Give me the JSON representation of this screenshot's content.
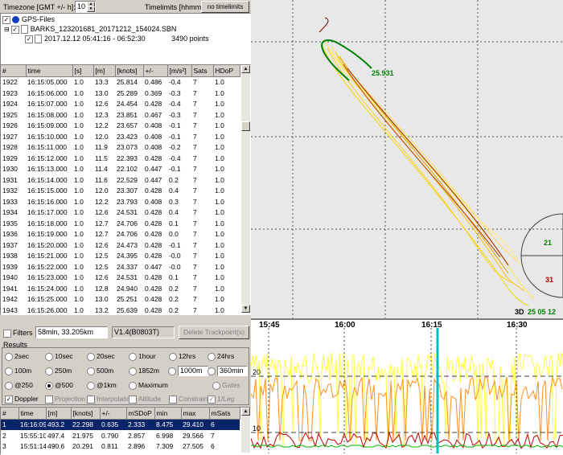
{
  "header": {
    "timezone_label": "Timezone [GMT +/- h]:",
    "timezone_value": "10",
    "timelimits_label": "Timelimits [hhmm]:",
    "timelimits_button": "no timelimits"
  },
  "tree": {
    "root_label": "GPS-Files",
    "file_label": "BARKS_123201681_20171212_154024.SBN",
    "segment_label": "2017.12.12 05:41:16 - 06:52:30",
    "points_label": "3490 points"
  },
  "trackpoints": {
    "columns": [
      "#",
      "time",
      "[s]",
      "[m]",
      "[knots]",
      "+/-",
      "[m/s²]",
      "Sats",
      "HDoP"
    ],
    "rows": [
      [
        "1922",
        "16:15:05.000",
        "1.0",
        "13.3",
        "25.814",
        "0.486",
        "-0.4",
        "7",
        "1.0"
      ],
      [
        "1923",
        "16:15:06.000",
        "1.0",
        "13.0",
        "25.289",
        "0.369",
        "-0.3",
        "7",
        "1.0"
      ],
      [
        "1924",
        "16:15:07.000",
        "1.0",
        "12.6",
        "24.454",
        "0.428",
        "-0.4",
        "7",
        "1.0"
      ],
      [
        "1925",
        "16:15:08.000",
        "1.0",
        "12.3",
        "23.851",
        "0.467",
        "-0.3",
        "7",
        "1.0"
      ],
      [
        "1926",
        "16:15:09.000",
        "1.0",
        "12.2",
        "23.657",
        "0.408",
        "-0.1",
        "7",
        "1.0"
      ],
      [
        "1927",
        "16:15:10.000",
        "1.0",
        "12.0",
        "23.423",
        "0.408",
        "-0.1",
        "7",
        "1.0"
      ],
      [
        "1928",
        "16:15:11.000",
        "1.0",
        "11.9",
        "23.073",
        "0.408",
        "-0.2",
        "7",
        "1.0"
      ],
      [
        "1929",
        "16:15:12.000",
        "1.0",
        "11.5",
        "22.393",
        "0.428",
        "-0.4",
        "7",
        "1.0"
      ],
      [
        "1930",
        "16:15:13.000",
        "1.0",
        "11.4",
        "22.102",
        "0.447",
        "-0.1",
        "7",
        "1.0"
      ],
      [
        "1931",
        "16:15:14.000",
        "1.0",
        "11.6",
        "22.529",
        "0.447",
        "0.2",
        "7",
        "1.0"
      ],
      [
        "1932",
        "16:15:15.000",
        "1.0",
        "12.0",
        "23.307",
        "0.428",
        "0.4",
        "7",
        "1.0"
      ],
      [
        "1933",
        "16:15:16.000",
        "1.0",
        "12.2",
        "23.793",
        "0.408",
        "0.3",
        "7",
        "1.0"
      ],
      [
        "1934",
        "16:15:17.000",
        "1.0",
        "12.6",
        "24.531",
        "0.428",
        "0.4",
        "7",
        "1.0"
      ],
      [
        "1935",
        "16:15:18.000",
        "1.0",
        "12.7",
        "24.706",
        "0.428",
        "0.1",
        "7",
        "1.0"
      ],
      [
        "1936",
        "16:15:19.000",
        "1.0",
        "12.7",
        "24.706",
        "0.428",
        "0.0",
        "7",
        "1.0"
      ],
      [
        "1937",
        "16:15:20.000",
        "1.0",
        "12.6",
        "24.473",
        "0.428",
        "-0.1",
        "7",
        "1.0"
      ],
      [
        "1938",
        "16:15:21.000",
        "1.0",
        "12.5",
        "24.395",
        "0.428",
        "-0.0",
        "7",
        "1.0"
      ],
      [
        "1939",
        "16:15:22.000",
        "1.0",
        "12.5",
        "24.337",
        "0.447",
        "-0.0",
        "7",
        "1.0"
      ],
      [
        "1940",
        "16:15:23.000",
        "1.0",
        "12.6",
        "24.531",
        "0.428",
        "0.1",
        "7",
        "1.0"
      ],
      [
        "1941",
        "16:15:24.000",
        "1.0",
        "12.8",
        "24.940",
        "0.428",
        "0.2",
        "7",
        "1.0"
      ],
      [
        "1942",
        "16:15:25.000",
        "1.0",
        "13.0",
        "25.251",
        "0.428",
        "0.2",
        "7",
        "1.0"
      ],
      [
        "1943",
        "16:15:26.000",
        "1.0",
        "13.2",
        "25.639",
        "0.428",
        "0.2",
        "7",
        "1.0"
      ],
      [
        "1944",
        "16:15:27.000",
        "1.0",
        "13.3",
        "25.931",
        "0.428",
        "0.1",
        "7",
        "1.0"
      ]
    ],
    "selected_index": 22
  },
  "filters": {
    "checkbox_label": "Filters",
    "summary": "58min, 33.205km",
    "version": "V1.4(B0803T)",
    "delete_button": "Delete Trackpoint(s)"
  },
  "results": {
    "group_label": "Results",
    "row1": [
      "2sec",
      "10sec",
      "20sec",
      "1hour",
      "12hrs",
      "24hrs"
    ],
    "row2": [
      "100m",
      "250m",
      "500m",
      "1852m",
      "1000m",
      "360min"
    ],
    "row3": [
      "@250",
      "@500",
      "@1km",
      "Maximum",
      "Gates"
    ],
    "row3_selected": "@500",
    "row1_selected": "",
    "checks": [
      "Doppler",
      "Projection",
      "Interpolation",
      "Altitude",
      "Constrain",
      "1/Leg"
    ],
    "columns": [
      "#",
      "time",
      "[m]",
      "[knots]",
      "+/-",
      "mSDoP",
      "min",
      "max",
      "mSats"
    ],
    "rows": [
      [
        "1",
        "16:16:09",
        "493.2",
        "22.298",
        "0.635",
        "2.333",
        "8.475",
        "29.410",
        "6"
      ],
      [
        "2",
        "15:55:10",
        "497.4",
        "21.975",
        "0.790",
        "2.857",
        "6.998",
        "29.566",
        "7"
      ],
      [
        "3",
        "15:51:14",
        "490.6",
        "20.291",
        "0.811",
        "2.896",
        "7.309",
        "27.505",
        "6"
      ]
    ]
  },
  "map": {
    "speed_label": "25.931",
    "compass_label_1": "21",
    "compass_label_2": "31",
    "status_3d": "3D",
    "status_time": "25 05 12"
  },
  "chart_data": {
    "type": "line",
    "x_ticks": [
      "15:45",
      "16:00",
      "16:15",
      "16:30"
    ],
    "y_ticks": [
      "20",
      "10"
    ],
    "cursor_label": "16:15",
    "colors": {
      "high": "#ffff40",
      "mid": "#ff9020",
      "low": "#c00000",
      "sats": "#00b000",
      "cursor": "#00c0c0"
    }
  }
}
